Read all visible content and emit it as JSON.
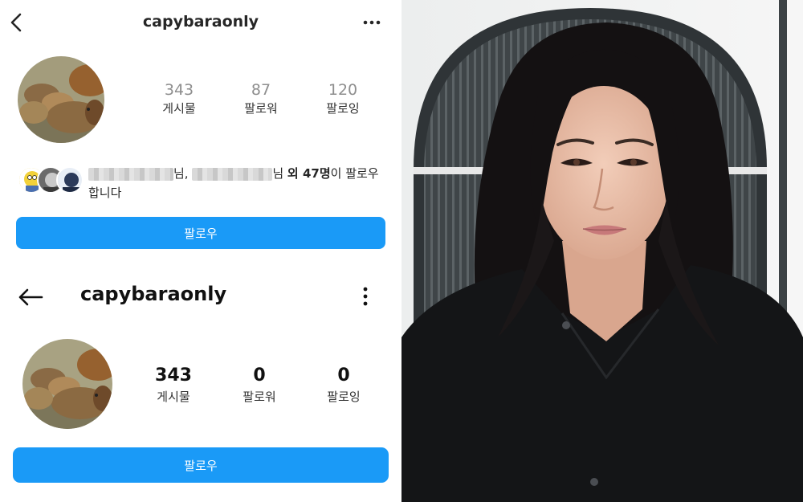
{
  "profile_a": {
    "username": "capybaraonly",
    "stats": [
      {
        "value": "343",
        "label": "게시물"
      },
      {
        "value": "87",
        "label": "팔로워"
      },
      {
        "value": "120",
        "label": "팔로잉"
      }
    ],
    "mutual": {
      "sep": "님, ",
      "suffix": "님 ",
      "count": "외 47명",
      "tail": "이 팔로우합니다"
    },
    "follow_label": "팔로우"
  },
  "profile_b": {
    "username": "capybaraonly",
    "stats": [
      {
        "value": "343",
        "label": "게시물"
      },
      {
        "value": "0",
        "label": "팔로워"
      },
      {
        "value": "0",
        "label": "팔로잉"
      }
    ],
    "follow_label": "팔로우"
  },
  "colors": {
    "follow_button": "#1a9af7",
    "background": "#ffffff"
  },
  "icons": {
    "back_a": "chevron-left-icon",
    "back_b": "arrow-left-icon",
    "more_a": "horizontal-dots-icon",
    "more_b": "vertical-dots-icon"
  }
}
